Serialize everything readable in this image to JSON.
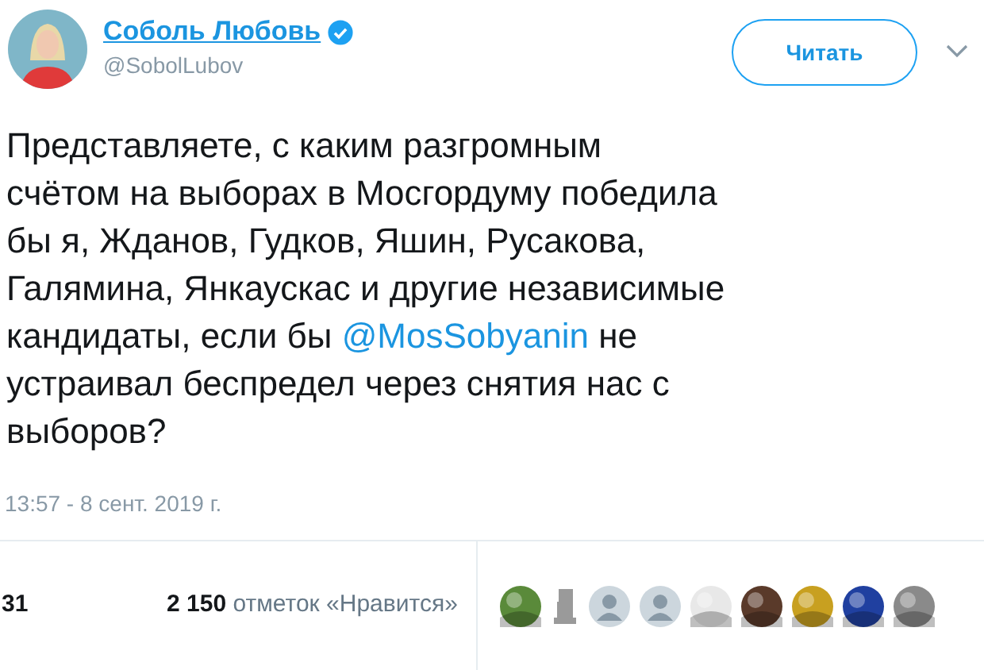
{
  "author": {
    "name": "Соболь Любовь",
    "handle": "@SobolLubov",
    "verified": true
  },
  "follow_button": {
    "label": "Читать"
  },
  "tweet": {
    "text_before": "Представляете, с каким разгромным\nсчётом на выборах в Мосгордуму победила\nбы я, Жданов, Гудков, Яшин, Русакова,\nГалямина, Янкаускас и другие независимые\nкандидаты, если бы ",
    "mention": "@MosSobyanin",
    "text_after": " не\nустраивал беспредел через снятия нас с\nвыборов?"
  },
  "timestamp": "13:57 - 8 сент. 2019 г.",
  "stats": {
    "retweets_count": "31",
    "likes_count": "2 150",
    "likes_label": "отметок «Нравится»"
  },
  "likers": [
    {
      "kind": "picture",
      "color": "#5a8a3a"
    },
    {
      "kind": "drawing",
      "color": "#9a9a9a"
    },
    {
      "kind": "default",
      "color": "#ccd6dd"
    },
    {
      "kind": "default",
      "color": "#ccd6dd"
    },
    {
      "kind": "picture",
      "color": "#e8e8e8"
    },
    {
      "kind": "picture",
      "color": "#5a3a2a"
    },
    {
      "kind": "picture",
      "color": "#c8a020"
    },
    {
      "kind": "picture",
      "color": "#2040a0"
    },
    {
      "kind": "picture",
      "color": "#8a8a8a"
    }
  ]
}
